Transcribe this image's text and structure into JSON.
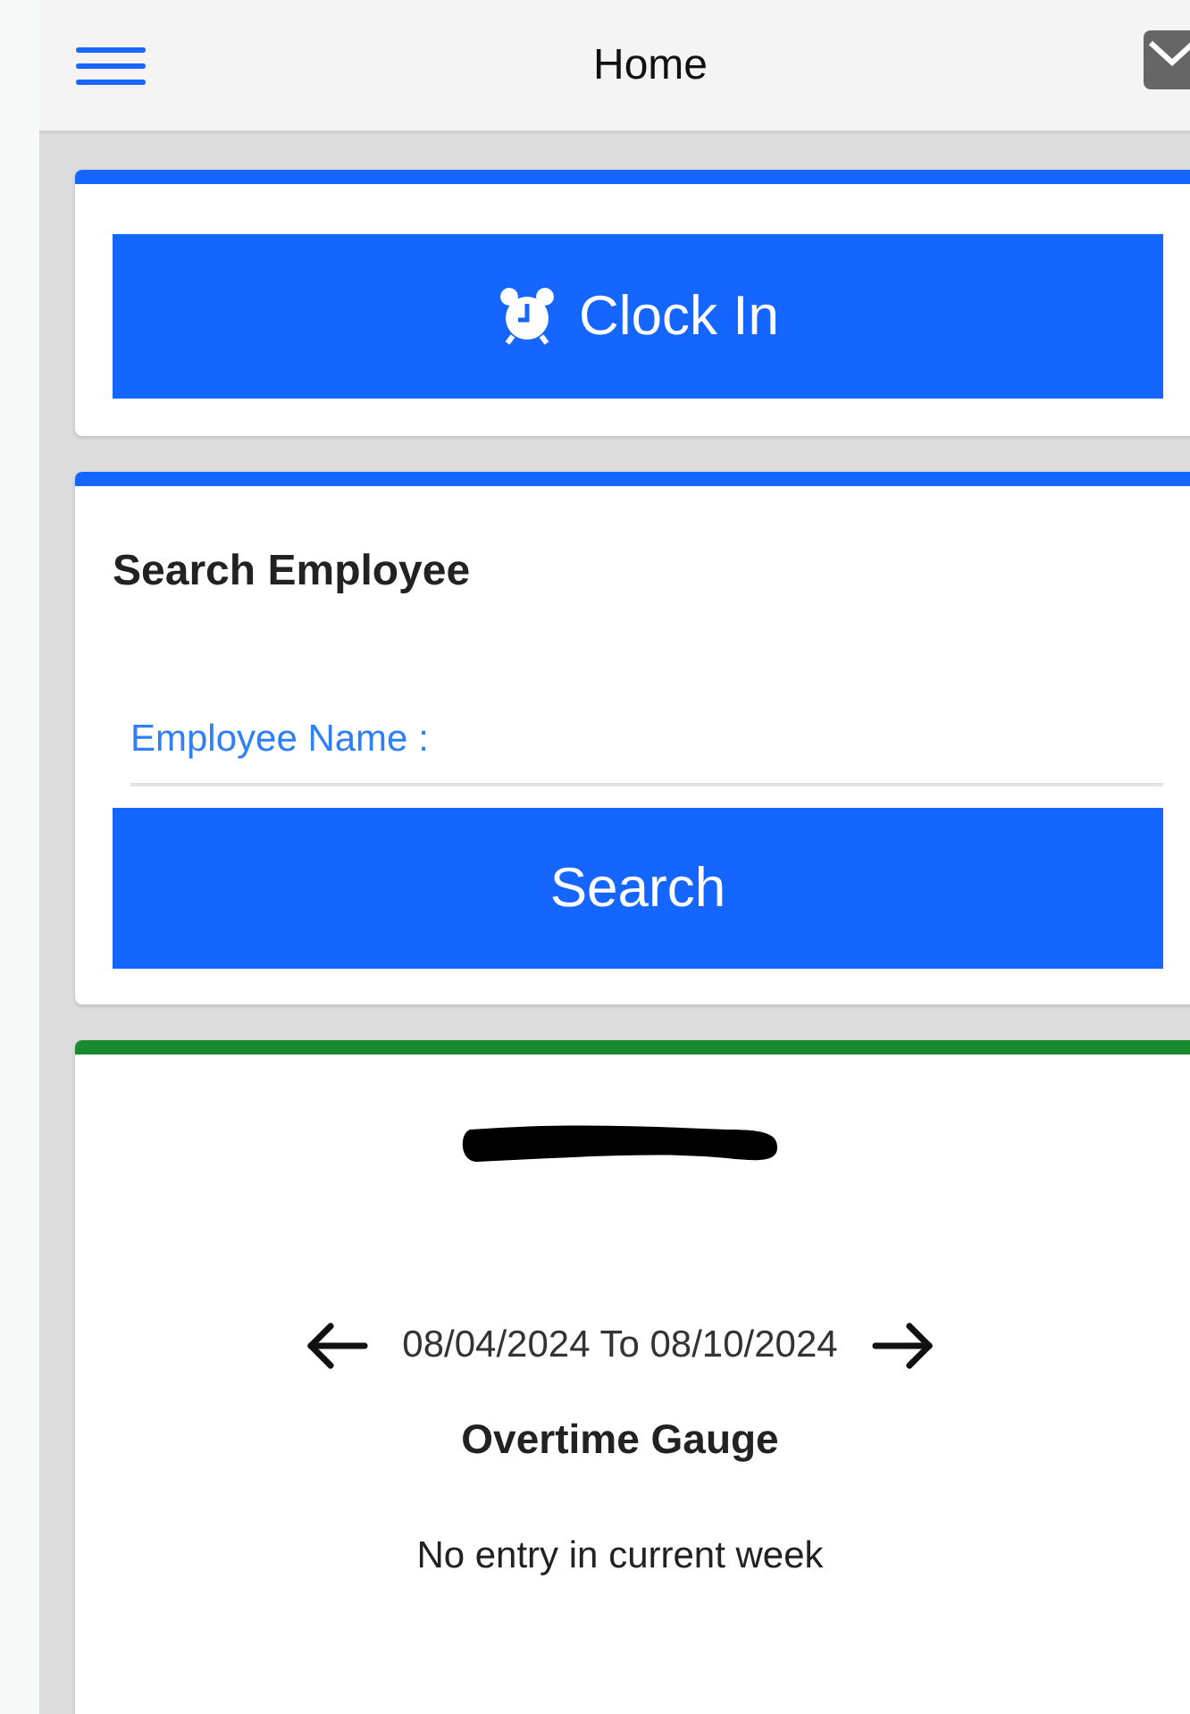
{
  "header": {
    "title": "Home"
  },
  "clock_card": {
    "button": "Clock In"
  },
  "search_card": {
    "title": "Search Employee",
    "field": {
      "placeholder": "Employee Name :"
    },
    "button": "Search"
  },
  "week_card": {
    "range": "08/04/2024 To 08/10/2024",
    "gauge_title": "Overtime Gauge",
    "message": "No entry in current week"
  }
}
